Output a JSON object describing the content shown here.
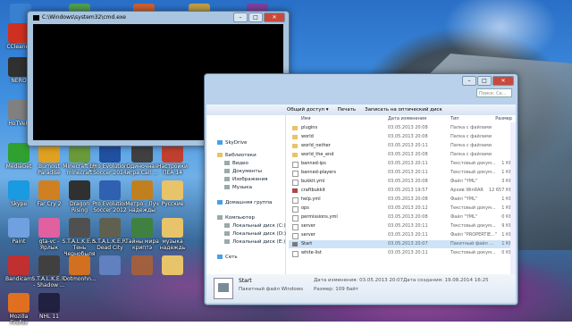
{
  "desktop": {
    "icons": [
      {
        "label": "",
        "color": "#3a80d0"
      },
      {
        "label": "",
        "color": "#50a050"
      },
      {
        "label": "",
        "color": "#d06030"
      },
      {
        "label": "",
        "color": "#c0a040"
      },
      {
        "label": "",
        "color": "#8040a0"
      },
      {
        "label": "CCleaner",
        "color": "#d03020"
      },
      {
        "label": "NERO",
        "color": "#303030"
      },
      {
        "label": "HoTVeR",
        "color": "#808080"
      },
      {
        "label": "MediaGet",
        "color": "#30a030"
      },
      {
        "label": "Burnout Paradise",
        "color": "#e0a020"
      },
      {
        "label": "Minecraft by minecraft",
        "color": "#6a9a3a"
      },
      {
        "label": "Pro Evolution Soccer 2014",
        "color": "#2050a0"
      },
      {
        "label": "Одиночная игра Call ...",
        "color": "#404040"
      },
      {
        "label": "Настройки ПЕА 14",
        "color": "#c04030"
      },
      {
        "label": "Skype",
        "color": "#1a9ae0"
      },
      {
        "label": "Far Cry 2",
        "color": "#d08020"
      },
      {
        "label": "Dragon Rising",
        "color": "#303030"
      },
      {
        "label": "Pro Evolution Soccer 2012",
        "color": "#3060b0"
      },
      {
        "label": "Метро - Луч надежды",
        "color": "#c08020"
      },
      {
        "label": "Русские",
        "color": "#e7c36a"
      },
      {
        "label": "Paint",
        "color": "#70a0e0"
      },
      {
        "label": "gta-vc - Ярлык",
        "color": "#e060a0"
      },
      {
        "label": "S.T.A.L.K.E.R. Тень Чернобыля",
        "color": "#505050"
      },
      {
        "label": "S.T.A.L.K.E.R. Dead City",
        "color": "#606050"
      },
      {
        "label": "Тайны мира криптэ",
        "color": "#408040"
      },
      {
        "label": "музыка надеждь",
        "color": "#e7c36a"
      },
      {
        "label": "Bandicam",
        "color": "#c03030"
      },
      {
        "label": "S.T.A.L.K.E.R. - Shadow ...",
        "color": "#404040"
      },
      {
        "label": "Dotmonhn...",
        "color": "#d07020"
      },
      {
        "label": "",
        "color": "#6080c0"
      },
      {
        "label": "",
        "color": "#a06040"
      },
      {
        "label": "",
        "color": "#e7c36a"
      },
      {
        "label": "Mozilla Firefox",
        "color": "#e07020"
      },
      {
        "label": "NHL 11",
        "color": "#202040"
      }
    ]
  },
  "cmd": {
    "title": "C:\\Windows\\system32\\cmd.exe",
    "minimize": "–",
    "maximize": "□",
    "close": "✕"
  },
  "explorer": {
    "search_placeholder": "Поиск: Се...",
    "minimize": "–",
    "maximize": "□",
    "close": "✕",
    "toolbar": [
      "Общий доступ ▾",
      "Печать",
      "Записать на оптический диск"
    ],
    "nav": {
      "skydrive": "SkyDrive",
      "libraries": "Библиотеки",
      "video": "Видео",
      "documents": "Документы",
      "images": "Изображения",
      "music": "Музыка",
      "homegroup": "Домашняя группа",
      "computer": "Компьютер",
      "disk_c": "Локальный диск (C:)",
      "disk_d": "Локальный диск (D:)",
      "disk_e": "Локальный диск (E:)",
      "network": "Сеть"
    },
    "columns": {
      "name": "Имя",
      "date": "Дата изменения",
      "type": "Тип",
      "size": "Размер"
    },
    "files": [
      {
        "name": "plugins",
        "date": "03.05.2013 20:08",
        "type": "Папка с файлами",
        "size": "",
        "kind": "folder"
      },
      {
        "name": "world",
        "date": "03.05.2013 20:08",
        "type": "Папка с файлами",
        "size": "",
        "kind": "folder"
      },
      {
        "name": "world_nether",
        "date": "03.05.2013 20:11",
        "type": "Папка с файлами",
        "size": "",
        "kind": "folder"
      },
      {
        "name": "world_the_end",
        "date": "03.05.2013 20:08",
        "type": "Папка с файлами",
        "size": "",
        "kind": "folder"
      },
      {
        "name": "banned-ips",
        "date": "03.05.2013 20:11",
        "type": "Текстовый докум...",
        "size": "1 КБ",
        "kind": "doc"
      },
      {
        "name": "banned-players",
        "date": "03.05.2013 20:11",
        "type": "Текстовый докум...",
        "size": "1 КБ",
        "kind": "doc"
      },
      {
        "name": "bukkit.yml",
        "date": "03.05.2013 20:08",
        "type": "Файл \"YML\"",
        "size": "3 КБ",
        "kind": "doc"
      },
      {
        "name": "craftbukkit",
        "date": "03.05.2013 19:57",
        "type": "Архив WinRAR",
        "size": "12 657 КБ",
        "kind": "zip"
      },
      {
        "name": "help.yml",
        "date": "03.05.2013 20:08",
        "type": "Файл \"YML\"",
        "size": "1 КБ",
        "kind": "doc"
      },
      {
        "name": "ops",
        "date": "03.05.2013 20:12",
        "type": "Текстовый докум...",
        "size": "1 КБ",
        "kind": "doc"
      },
      {
        "name": "permissions.yml",
        "date": "03.05.2013 20:08",
        "type": "Файл \"YML\"",
        "size": "0 КБ",
        "kind": "doc"
      },
      {
        "name": "server",
        "date": "03.05.2013 20:11",
        "type": "Текстовый докум...",
        "size": "9 КБ",
        "kind": "doc"
      },
      {
        "name": "server",
        "date": "03.05.2013 20:11",
        "type": "Файл \"PROPERTIE...\"",
        "size": "1 КБ",
        "kind": "doc"
      },
      {
        "name": "Start",
        "date": "03.05.2013 20:07",
        "type": "Пакетный файл ...",
        "size": "1 КБ",
        "kind": "bat"
      },
      {
        "name": "white-list",
        "date": "03.05.2013 20:11",
        "type": "Текстовый докум...",
        "size": "0 КБ",
        "kind": "doc"
      }
    ],
    "details": {
      "name": "Start",
      "type": "Пакетный файл Windows",
      "modified_label": "Дата изменения: 03.05.2013 20:07",
      "created_label": "Дата создания: 19.08.2014 16:25",
      "size_label": "Размер: 109 байт"
    }
  }
}
